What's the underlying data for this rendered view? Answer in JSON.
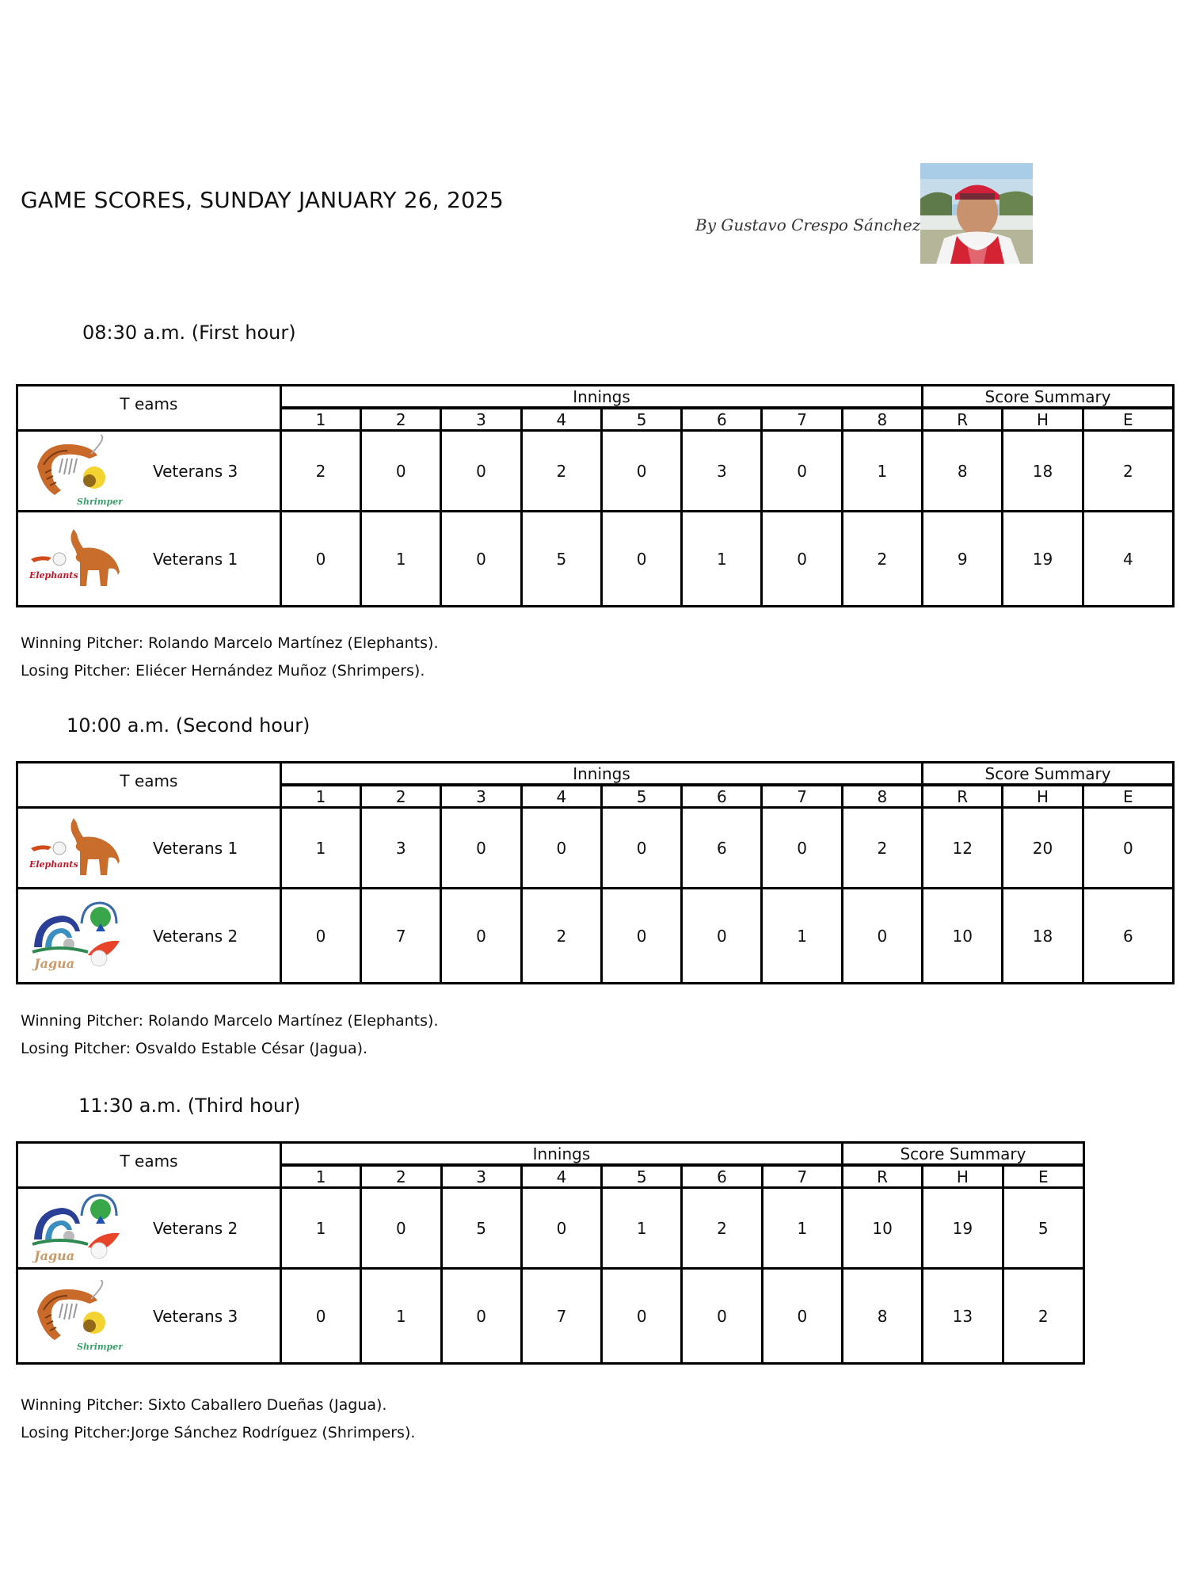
{
  "header": {
    "title": "GAME SCORES, SUNDAY JANUARY 26, 2025",
    "byline": "By Gustavo Crespo Sánchez",
    "photo_icon": "author-photo"
  },
  "table_labels": {
    "teams": "T eams",
    "innings": "Innings",
    "summary": "Score Summary",
    "r": "R",
    "h": "H",
    "e": "E"
  },
  "games": [
    {
      "slot": "08:30 a.m. (First hour)",
      "innings_headers": [
        "1",
        "2",
        "3",
        "4",
        "5",
        "6",
        "7",
        "8"
      ],
      "rows": [
        {
          "logo": "shrimpers-logo",
          "logo_text": "Shrimpers",
          "team": "Veterans 3",
          "innings": [
            "2",
            "0",
            "0",
            "2",
            "0",
            "3",
            "0",
            "1"
          ],
          "r": "8",
          "h": "18",
          "e": "2"
        },
        {
          "logo": "elephants-logo",
          "logo_text": "Elephants",
          "team": "Veterans 1",
          "innings": [
            "0",
            "1",
            "0",
            "5",
            "0",
            "1",
            "0",
            "2"
          ],
          "r": "9",
          "h": "19",
          "e": "4"
        }
      ],
      "winning": "Winning Pitcher: Rolando Marcelo Martínez (Elephants).",
      "losing": "Losing Pitcher: Eliécer Hernández Muñoz (Shrimpers)."
    },
    {
      "slot": "10:00 a.m. (Second hour)",
      "innings_headers": [
        "1",
        "2",
        "3",
        "4",
        "5",
        "6",
        "7",
        "8"
      ],
      "rows": [
        {
          "logo": "elephants-logo",
          "logo_text": "Elephants",
          "team": "Veterans 1",
          "innings": [
            "1",
            "3",
            "0",
            "0",
            "0",
            "6",
            "0",
            "2"
          ],
          "r": "12",
          "h": "20",
          "e": "0"
        },
        {
          "logo": "jagua-logo",
          "logo_text": "Jagua",
          "team": "Veterans 2",
          "innings": [
            "0",
            "7",
            "0",
            "2",
            "0",
            "0",
            "1",
            "0"
          ],
          "r": "10",
          "h": "18",
          "e": "6"
        }
      ],
      "winning": "Winning Pitcher: Rolando Marcelo Martínez (Elephants).",
      "losing": "Losing Pitcher: Osvaldo Estable César (Jagua)."
    },
    {
      "slot": "11:30 a.m. (Third hour)",
      "innings_headers": [
        "1",
        "2",
        "3",
        "4",
        "5",
        "6",
        "7"
      ],
      "rows": [
        {
          "logo": "jagua-logo",
          "logo_text": "Jagua",
          "team": "Veterans 2",
          "innings": [
            "1",
            "0",
            "5",
            "0",
            "1",
            "2",
            "1"
          ],
          "r": "10",
          "h": "19",
          "e": "5"
        },
        {
          "logo": "shrimpers-logo",
          "logo_text": "Shrimpers",
          "team": "Veterans 3",
          "innings": [
            "0",
            "1",
            "0",
            "7",
            "0",
            "0",
            "0"
          ],
          "r": "8",
          "h": "13",
          "e": "2"
        }
      ],
      "winning": "Winning Pitcher: Sixto Caballero Dueñas (Jagua).",
      "losing": "Losing Pitcher:Jorge Sánchez Rodríguez (Shrimpers)."
    }
  ]
}
